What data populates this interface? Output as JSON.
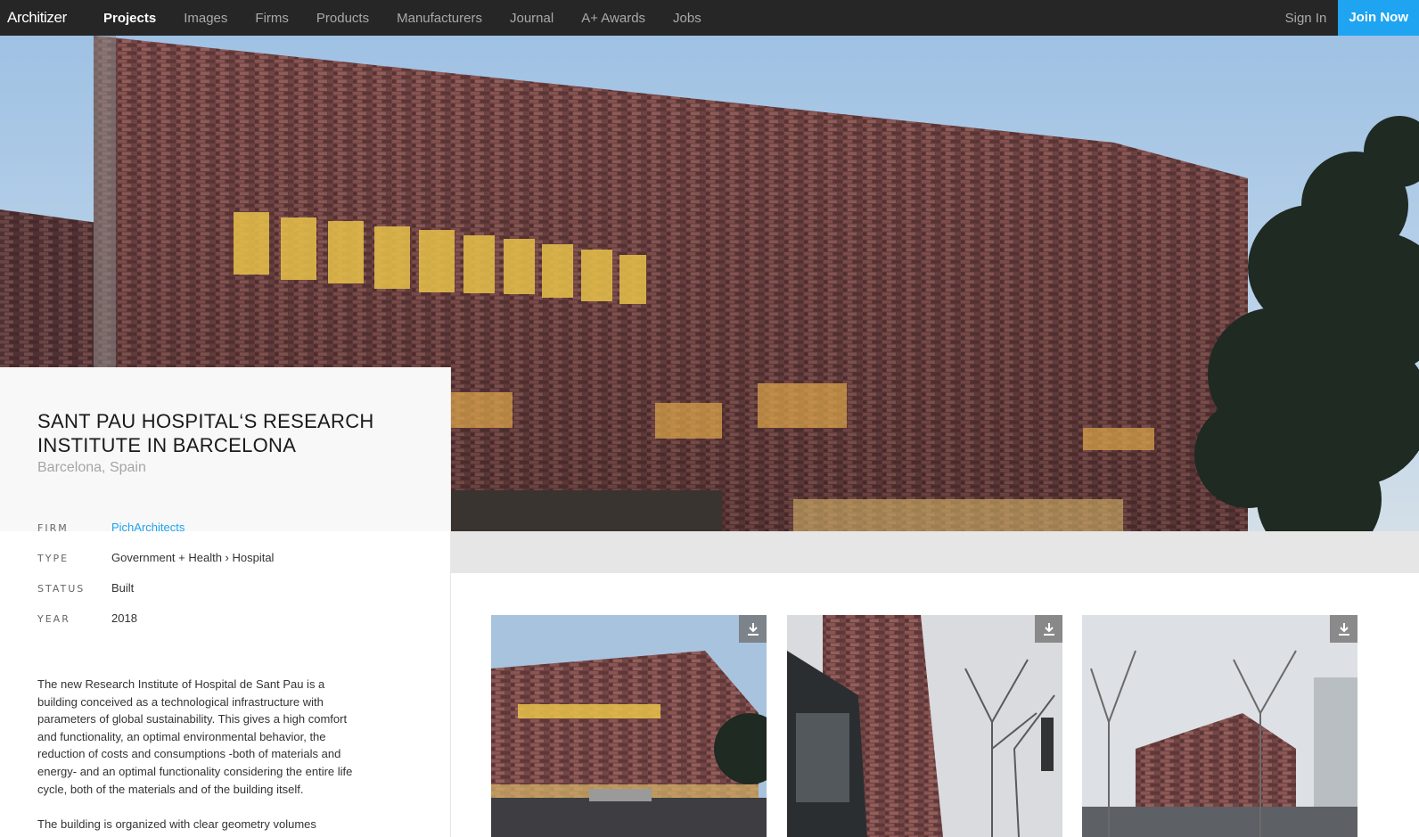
{
  "nav": {
    "logo": "Architizer",
    "links": [
      "Projects",
      "Images",
      "Firms",
      "Products",
      "Manufacturers",
      "Journal",
      "A+ Awards",
      "Jobs"
    ],
    "sign_in": "Sign In",
    "join": "Join Now"
  },
  "project": {
    "title": "SANT PAU HOSPITAL‘S RESEARCH INSTITUTE IN BARCELONA",
    "location": "Barcelona, Spain",
    "meta": [
      {
        "label": "FIRM",
        "value": "PichArchitects"
      },
      {
        "label": "TYPE",
        "value": "Government + Health › Hospital"
      },
      {
        "label": "STATUS",
        "value": "Built"
      },
      {
        "label": "YEAR",
        "value": "2018"
      }
    ],
    "description": "The new Research Institute of Hospital de Sant Pau is a building conceived as a technological infrastructure with parameters of global sustainability. This gives a high comfort and functionality, an optimal environmental behavior, the reduction of costs and consumptions -both of materials and energy- and an optimal functionality considering the entire life cycle, both of the materials and of the building itself.",
    "description_2": "The building is organized with clear geometry volumes"
  },
  "icons": {
    "download": "download-icon"
  },
  "colors": {
    "nav_bg": "#262626",
    "accent": "#1ea4f0",
    "facade": "#7a4a4a"
  }
}
